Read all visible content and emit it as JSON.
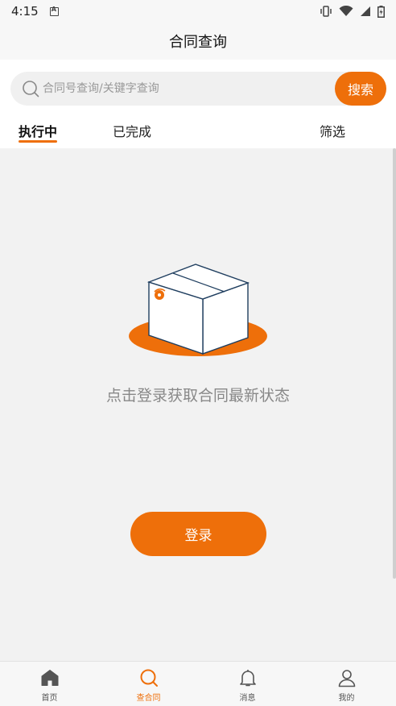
{
  "status_bar": {
    "time": "4:15"
  },
  "header": {
    "title": "合同查询"
  },
  "search": {
    "placeholder": "合同号查询/关键字查询",
    "button_label": "搜索"
  },
  "tabs": [
    {
      "label": "执行中",
      "active": true
    },
    {
      "label": "已完成",
      "active": false
    },
    {
      "label": "筛选",
      "active": false
    }
  ],
  "empty_state": {
    "message": "点击登录获取合同最新状态",
    "login_label": "登录"
  },
  "bottom_nav": [
    {
      "label": "首页",
      "icon": "home-icon",
      "active": false
    },
    {
      "label": "查合同",
      "icon": "search-icon",
      "active": true
    },
    {
      "label": "消息",
      "icon": "bell-icon",
      "active": false
    },
    {
      "label": "我的",
      "icon": "person-icon",
      "active": false
    }
  ],
  "colors": {
    "accent": "#ee6f0a",
    "background": "#f2f2f2",
    "muted_text": "#888888"
  }
}
